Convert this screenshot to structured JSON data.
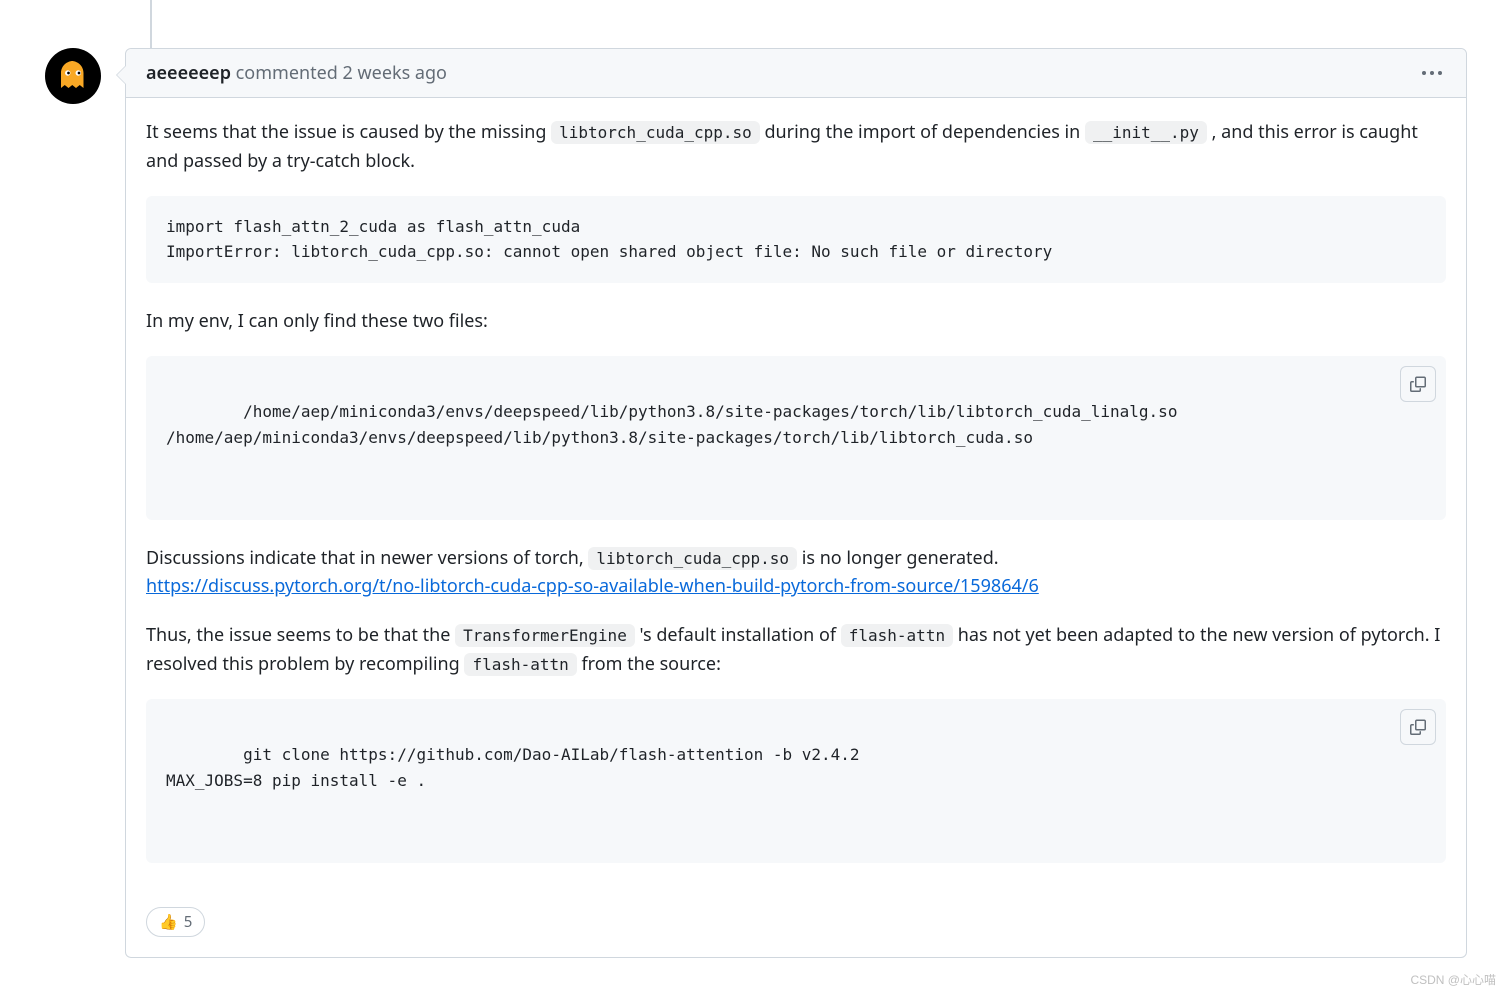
{
  "comment": {
    "author": "aeeeeeep",
    "action": "commented",
    "timestamp": "2 weeks ago",
    "body": {
      "p1_before": "It seems that the issue is caused by the missing ",
      "p1_code1": "libtorch_cuda_cpp.so",
      "p1_mid": " during the import of dependencies in ",
      "p1_code2": "__init__.py",
      "p1_after": " , and this error is caught and passed by a try-catch block.",
      "code_block_1": "import flash_attn_2_cuda as flash_attn_cuda\nImportError: libtorch_cuda_cpp.so: cannot open shared object file: No such file or directory",
      "p2": "In my env, I can only find these two files:",
      "code_block_2": "/home/aep/miniconda3/envs/deepspeed/lib/python3.8/site-packages/torch/lib/libtorch_cuda_linalg.so\n/home/aep/miniconda3/envs/deepspeed/lib/python3.8/site-packages/torch/lib/libtorch_cuda.so",
      "p3_before": "Discussions indicate that in newer versions of torch, ",
      "p3_code": "libtorch_cuda_cpp.so",
      "p3_after": " is no longer generated.",
      "link": "https://discuss.pytorch.org/t/no-libtorch-cuda-cpp-so-available-when-build-pytorch-from-source/159864/6",
      "p4_before": "Thus, the issue seems to be that the ",
      "p4_code1": "TransformerEngine",
      "p4_mid1": " 's default installation of ",
      "p4_code2": "flash-attn",
      "p4_mid2": " has not yet been adapted to the new version of pytorch. I resolved this problem by recompiling ",
      "p4_code3": "flash-attn",
      "p4_after": " from the source:",
      "code_block_3": "git clone https://github.com/Dao-AILab/flash-attention -b v2.4.2\nMAX_JOBS=8 pip install -e ."
    },
    "reaction": {
      "emoji": "👍",
      "count": "5"
    }
  },
  "watermark": "CSDN @心心喵"
}
